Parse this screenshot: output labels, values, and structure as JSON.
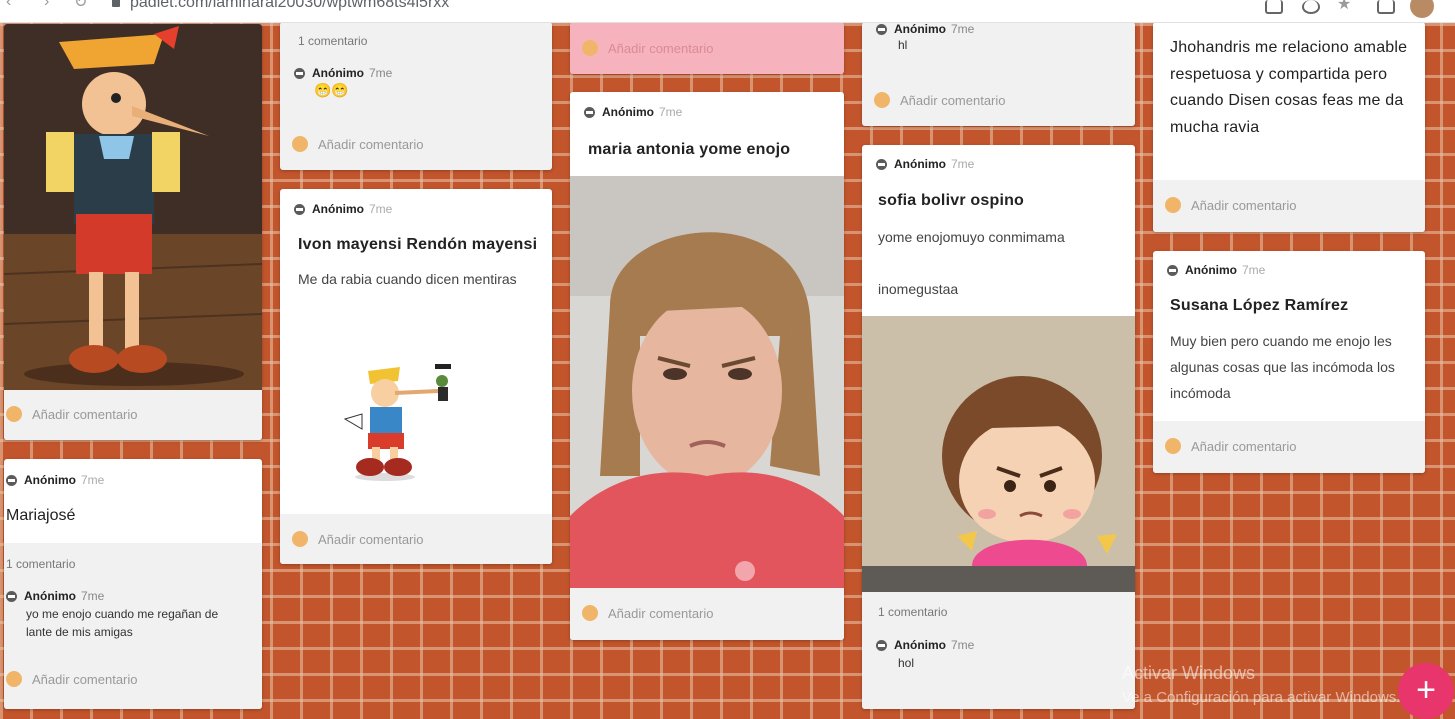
{
  "browser": {
    "url": "padlet.com/laminarai20030/wptwm68ts4i5rxx"
  },
  "comment_placeholder": "Añadir comentario",
  "cards": {
    "c1_pinocchio": {},
    "c2_top": {
      "count": "1 comentario",
      "comment_author": "Anónimo",
      "comment_time": "7me",
      "comment_text": "😁😁"
    },
    "c3_ivon": {
      "author": "Anónimo",
      "time": "7me",
      "title": "Ivon mayensi Rendón mayensi",
      "body": "Me da rabia cuando dicen mentiras"
    },
    "c4_maria": {
      "author": "Anónimo",
      "time": "7me",
      "title": "maria antonia yome enojo"
    },
    "c5_hl": {
      "comment_author": "Anónimo",
      "comment_time": "7me",
      "comment_text": "hl"
    },
    "c6_sofia": {
      "author": "Anónimo",
      "time": "7me",
      "title": "sofia  bolivr  ospino",
      "body1": "yome enojomuyo  conmimama",
      "body2": "inomegustaa",
      "count": "1 comentario",
      "comment_author": "Anónimo",
      "comment_time": "7me",
      "comment_text": "hol"
    },
    "c7_jhohandris": {
      "title": "Jhohandris me relaciono amable respetuosa y compartida pero cuando Disen cosas feas me da mucha ravia"
    },
    "c8_susana": {
      "author": "Anónimo",
      "time": "7me",
      "title": "Susana López Ramírez",
      "body": "Muy bien pero cuando me enojo les algunas cosas que las incómoda los incómoda"
    },
    "c9_mariajose": {
      "author": "Anónimo",
      "time": "7me",
      "title": "Mariajosé",
      "count": "1 comentario",
      "comment_author": "Anónimo",
      "comment_time": "7me",
      "comment_text": "yo me enojo cuando me regañan de lante de mis amigas"
    }
  },
  "watermark": {
    "line1": "Activar Windows",
    "line2": "Ve a Configuración para activar Windows."
  },
  "fab_label": "+",
  "colors": {
    "brick": "#c2552c",
    "pink_card": "#f7b3bd",
    "fab": "#e8356b",
    "comment_dot": "#f1b56a"
  }
}
